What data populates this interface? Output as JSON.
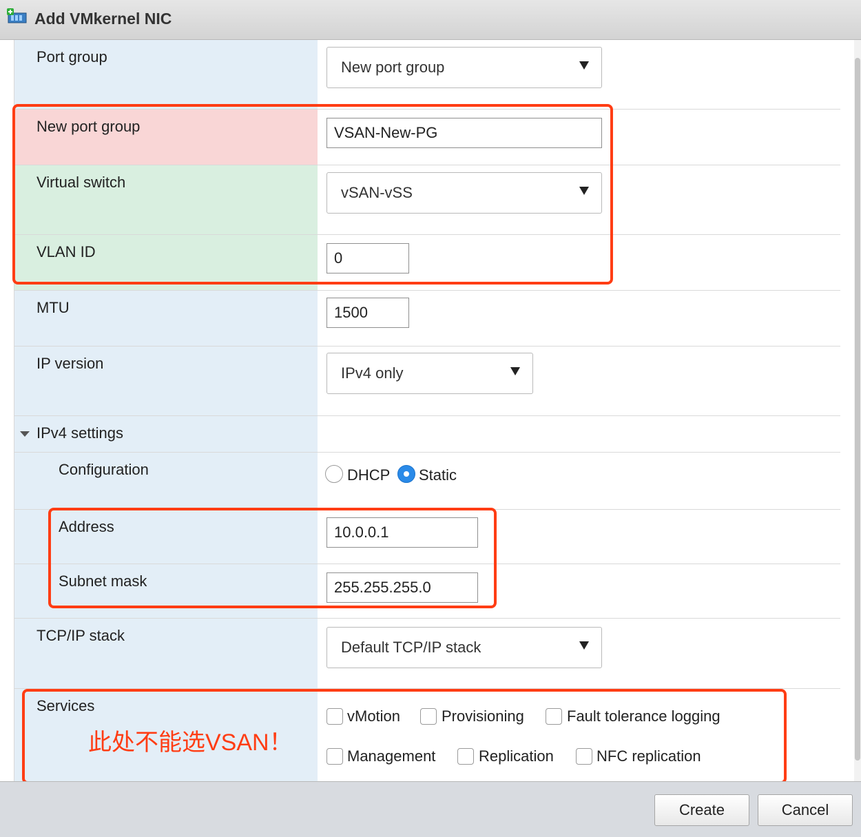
{
  "dialog": {
    "title": "Add VMkernel NIC",
    "icon": "vmkernel-nic-add-icon"
  },
  "form": {
    "port_group": {
      "label": "Port group",
      "value": "New port group"
    },
    "new_port_group": {
      "label": "New port group",
      "value": "VSAN-New-PG"
    },
    "virtual_switch": {
      "label": "Virtual switch",
      "value": "vSAN-vSS"
    },
    "vlan_id": {
      "label": "VLAN ID",
      "value": "0"
    },
    "mtu": {
      "label": "MTU",
      "value": "1500"
    },
    "ip_version": {
      "label": "IP version",
      "value": "IPv4 only"
    },
    "ipv4_settings": {
      "label": "IPv4 settings",
      "configuration": {
        "label": "Configuration",
        "options": [
          "DHCP",
          "Static"
        ],
        "selected": "Static"
      },
      "address": {
        "label": "Address",
        "value": "10.0.0.1"
      },
      "subnet_mask": {
        "label": "Subnet mask",
        "value": "255.255.255.0"
      }
    },
    "tcpip_stack": {
      "label": "TCP/IP stack",
      "value": "Default TCP/IP stack"
    },
    "services": {
      "label": "Services",
      "items": [
        {
          "label": "vMotion",
          "checked": false
        },
        {
          "label": "Provisioning",
          "checked": false
        },
        {
          "label": "Fault tolerance logging",
          "checked": false
        },
        {
          "label": "Management",
          "checked": false
        },
        {
          "label": "Replication",
          "checked": false
        },
        {
          "label": "NFC replication",
          "checked": false
        }
      ]
    }
  },
  "annotation": {
    "note": "此处不能选VSAN！",
    "color": "#ff3d14"
  },
  "buttons": {
    "create": "Create",
    "cancel": "Cancel"
  }
}
